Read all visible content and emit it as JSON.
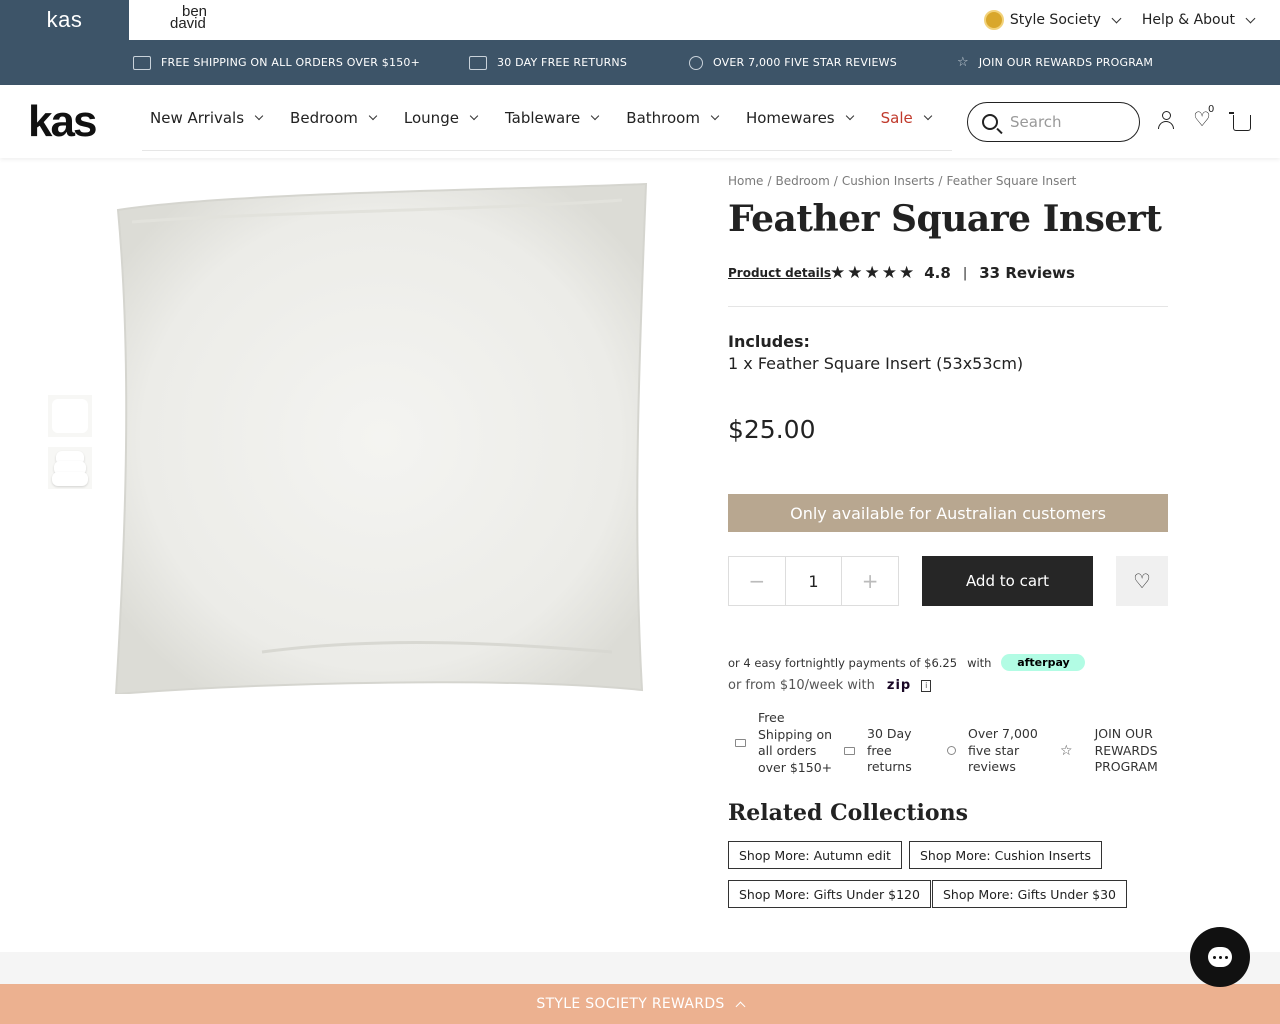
{
  "brands": {
    "primary": "kas",
    "secondary": [
      "ben",
      "david"
    ]
  },
  "top_links": {
    "style_society": "Style Society",
    "help": "Help & About"
  },
  "usp": [
    {
      "icon": "truck-icon",
      "label": "FREE SHIPPING ON ALL ORDERS OVER $150+"
    },
    {
      "icon": "box-icon",
      "label": "30 DAY FREE RETURNS"
    },
    {
      "icon": "award-icon",
      "label": "OVER 7,000 FIVE STAR REVIEWS"
    },
    {
      "icon": "star-icon",
      "label": "JOIN OUR REWARDS PROGRAM"
    }
  ],
  "header": {
    "logo": "kas",
    "nav": [
      "New Arrivals",
      "Bedroom",
      "Lounge",
      "Tableware",
      "Bathroom",
      "Homewares",
      "Sale"
    ],
    "search_placeholder": "Search",
    "wishlist_count": "0"
  },
  "breadcrumb": [
    "Home",
    "/",
    "Bedroom",
    "/",
    "Cushion Inserts",
    "/",
    "Feather Square Insert"
  ],
  "product": {
    "title": "Feather Square Insert",
    "details_link": "Product details",
    "rating": "4.8",
    "rating_sep": "|",
    "reviews": "33 Reviews",
    "includes_heading": "Includes:",
    "includes_text": "1 x Feather Square Insert (53x53cm)",
    "price": "$25.00",
    "availability_notice": "Only available for Australian customers",
    "quantity": "1",
    "add_to_cart": "Add to cart"
  },
  "payments": {
    "afterpay_text": "or 4 easy fortnightly payments of $6.25",
    "afterpay_with": "with",
    "afterpay_brand": "afterpay",
    "zip_text": "or from $10/week with",
    "zip_brand": "zip"
  },
  "mini_usp": [
    {
      "label": "Free Shipping on all orders over $150+"
    },
    {
      "label": "30 Day free returns"
    },
    {
      "label": "Over 7,000 five star reviews"
    },
    {
      "label": "JOIN OUR REWARDS PROGRAM"
    }
  ],
  "related": {
    "heading": "Related Collections",
    "tags": [
      "Shop More: Autumn edit",
      "Shop More: Cushion Inserts",
      "Shop More: Gifts Under $120",
      "Shop More: Gifts Under $30"
    ]
  },
  "rewards_bar": "STYLE SOCIETY REWARDS",
  "colors": {
    "navy": "#3d5468",
    "sale": "#c0392b",
    "notice": "#b8a790",
    "rewards": "#ecb190",
    "afterpay": "#b2fce4"
  }
}
